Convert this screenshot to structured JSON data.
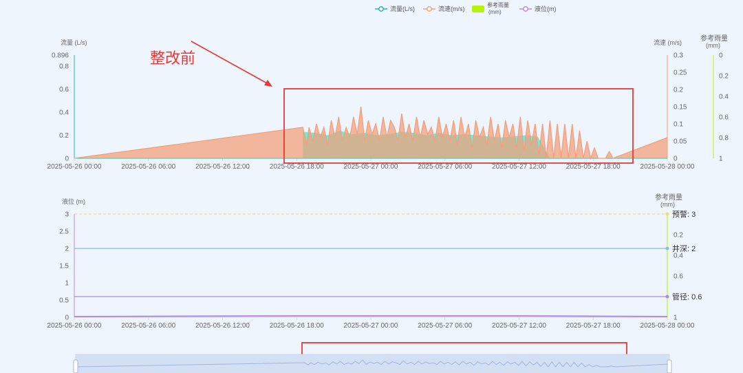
{
  "legend": {
    "items": [
      {
        "label": "流量(L/s)",
        "color": "#2ab5b0",
        "kind": "line"
      },
      {
        "label": "流速(m/s)",
        "color": "#f2a07b",
        "kind": "line"
      },
      {
        "label_l1": "参考雨量",
        "label_l2": "(mm)",
        "color": "#b6f20c",
        "kind": "bar"
      },
      {
        "label": "液位(m)",
        "color": "#b58be0",
        "kind": "line"
      }
    ]
  },
  "annotation": {
    "text": "整改前",
    "color": "#e53935"
  },
  "chart_data": [
    {
      "type": "area",
      "ylabel_left": "流量 (L/s)",
      "ylabel_right": "流速 (m/s)",
      "ylabel_right2_l1": "参考雨量",
      "ylabel_right2_l2": "(mm)",
      "left_ticks": [
        "0",
        "0.2",
        "0.4",
        "0.6",
        "0.8",
        "0.896"
      ],
      "left_max": 0.896,
      "right_ticks": [
        "0",
        "0.05",
        "0.1",
        "0.15",
        "0.2",
        "0.25",
        "0.3"
      ],
      "right_max": 0.3,
      "rain_ticks": [
        "0",
        "0.2",
        "0.4",
        "0.6",
        "0.8",
        "1"
      ],
      "rain_inverted": true,
      "x_ticks": [
        "2025-05-26 00:00",
        "2025-05-26 06:00",
        "2025-05-26 12:00",
        "2025-05-26 18:00",
        "2025-05-27 00:00",
        "2025-05-27 06:00",
        "2025-05-27 12:00",
        "2025-05-27 18:00",
        "2025-05-28 00:00"
      ],
      "x_range_hours": [
        0,
        48
      ],
      "series": [
        {
          "name": "流量(L/s)",
          "color": "#2ab5b0",
          "fill": "#5fe8d8",
          "x_hours": [
            18.5,
            19.5,
            20.5,
            21.5,
            22.5,
            23.5,
            24.5,
            25.5,
            26.5,
            27.5,
            28.5,
            29.5,
            30.5,
            31.5,
            32.5,
            33.5,
            34.5,
            35.5,
            36.5,
            37.5,
            38.5
          ],
          "values": [
            0.23,
            0.22,
            0.2,
            0.24,
            0.21,
            0.22,
            0.2,
            0.21,
            0.23,
            0.22,
            0.2,
            0.22,
            0.2,
            0.21,
            0.2,
            0.19,
            0.18,
            0.19,
            0.2,
            0.19,
            0.0
          ]
        },
        {
          "name": "流速(m/s)",
          "color": "#f2a07b",
          "x_hours": [
            0,
            18.5,
            18.8,
            19.0,
            19.3,
            19.6,
            19.9,
            20.2,
            20.5,
            20.8,
            21.1,
            21.4,
            21.7,
            22.0,
            22.3,
            22.6,
            22.9,
            23.2,
            23.5,
            23.8,
            24.1,
            24.4,
            24.7,
            25.0,
            25.3,
            25.6,
            25.9,
            26.2,
            26.5,
            26.8,
            27.1,
            27.4,
            27.7,
            28.0,
            28.3,
            28.6,
            28.9,
            29.2,
            29.5,
            29.8,
            30.1,
            30.4,
            30.7,
            31.0,
            31.3,
            31.6,
            31.9,
            32.2,
            32.5,
            32.8,
            33.1,
            33.4,
            33.7,
            34.0,
            34.3,
            34.6,
            34.9,
            35.2,
            35.5,
            35.8,
            36.1,
            36.4,
            36.7,
            37.0,
            37.3,
            37.6,
            37.9,
            38.2,
            38.5,
            38.8,
            39.1,
            39.4,
            39.7,
            40.0,
            40.3,
            40.6,
            40.9,
            41.2,
            41.5,
            41.8,
            42.1,
            42.4,
            42.7,
            43.0,
            43.3,
            43.6,
            48.0
          ],
          "values": [
            0,
            0.09,
            0.04,
            0.09,
            0.05,
            0.1,
            0.06,
            0.09,
            0.04,
            0.11,
            0.06,
            0.12,
            0.05,
            0.09,
            0.06,
            0.12,
            0.07,
            0.15,
            0.05,
            0.11,
            0.07,
            0.1,
            0.05,
            0.12,
            0.06,
            0.11,
            0.09,
            0.05,
            0.13,
            0.06,
            0.1,
            0.05,
            0.12,
            0.06,
            0.11,
            0.07,
            0.09,
            0.05,
            0.12,
            0.06,
            0.1,
            0.05,
            0.11,
            0.04,
            0.12,
            0.06,
            0.1,
            0.03,
            0.11,
            0.06,
            0.09,
            0.04,
            0.12,
            0.05,
            0.1,
            0.03,
            0.11,
            0.06,
            0.1,
            0.03,
            0.12,
            0.02,
            0.11,
            0.04,
            0.1,
            0.01,
            0.1,
            0.0,
            0.11,
            0.0,
            0.1,
            0.0,
            0.1,
            0.0,
            0.1,
            0.0,
            0.08,
            0.0,
            0.05,
            0.0,
            0.03,
            0.0,
            0.0,
            0.0,
            0.02,
            0.0,
            0.06
          ]
        }
      ]
    },
    {
      "type": "line",
      "ylabel_left": "液位 (m)",
      "ylabel_right_l1": "参考雨量",
      "ylabel_right_l2": "(mm)",
      "left_ticks": [
        "0",
        "0.5",
        "1",
        "1.5",
        "2",
        "2.5",
        "3"
      ],
      "left_max": 3,
      "rain_ticks": [
        "0.2",
        "0.4",
        "0.6",
        "1"
      ],
      "x_ticks": [
        "2025-05-26 00:00",
        "2025-05-26 06:00",
        "2025-05-26 12:00",
        "2025-05-26 18:00",
        "2025-05-27 00:00",
        "2025-05-27 06:00",
        "2025-05-27 12:00",
        "2025-05-27 18:00",
        "2025-05-28 00:00"
      ],
      "x_range_hours": [
        0,
        48
      ],
      "mark_lines": [
        {
          "label": "预警: 3",
          "value": 3,
          "color": "#e8e07a",
          "dashed": true
        },
        {
          "label": "井深: 2",
          "value": 2,
          "color": "#8bb8ec",
          "dashed": false
        },
        {
          "label": "管径: 0.6",
          "value": 0.6,
          "color": "#a58ae0",
          "dashed": false
        }
      ],
      "series": [
        {
          "name": "液位(m)",
          "color": "#b58be0",
          "x_hours": [
            0,
            18.5,
            36,
            48
          ],
          "values": [
            0,
            0.02,
            0.02,
            0
          ]
        }
      ]
    }
  ]
}
